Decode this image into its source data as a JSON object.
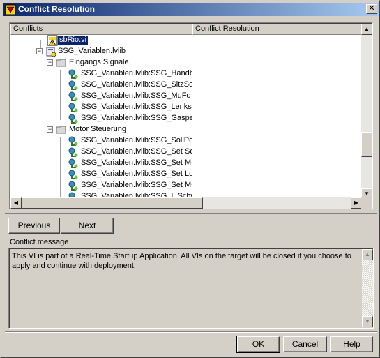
{
  "window": {
    "title": "Conflict Resolution",
    "close_glyph": "✕"
  },
  "columns": {
    "conflicts": "Conflicts",
    "resolution": "Conflict Resolution"
  },
  "tree": {
    "items": [
      {
        "label": "sbRio.vi",
        "selected": true
      },
      {
        "label": "SSG_Variablen.lvlib"
      },
      {
        "label": "Eingangs Signale"
      },
      {
        "label": "SSG_Variablen.lvlib:SSG_Handbo"
      },
      {
        "label": "SSG_Variablen.lvlib:SSG_SitzScha"
      },
      {
        "label": "SSG_Variablen.lvlib:SSG_MuFo"
      },
      {
        "label": "SSG_Variablen.lvlib:SSG_Lenksch"
      },
      {
        "label": "SSG_Variablen.lvlib:SSG_Gasped"
      },
      {
        "label": "Motor Steuerung"
      },
      {
        "label": "SSG_Variablen.lvlib:SSG_SollPosit"
      },
      {
        "label": "SSG_Variablen.lvlib:SSG_Set Solll"
      },
      {
        "label": "SSG_Variablen.lvlib:SSG_Set M-"
      },
      {
        "label": "SSG_Variablen.lvlib:SSG_Set Lorc"
      },
      {
        "label": "SSG_Variablen.lvlib:SSG_Set M+"
      },
      {
        "label": "SSG_Variablen.lvlib:SSG_I_Schwe"
      }
    ],
    "expander_minus": "−"
  },
  "nav": {
    "previous": "Previous",
    "next": "Next"
  },
  "message": {
    "label": "Conflict message",
    "text": "This VI is part of a Real-Time Startup Application. All VIs on the target will be closed if you choose to apply and continue with deployment."
  },
  "footer": {
    "ok": "OK",
    "cancel": "Cancel",
    "help": "Help"
  },
  "scroll": {
    "up": "▲",
    "down": "▼",
    "left": "◀",
    "right": "▶"
  },
  "icons": {
    "title": "labview-app-icon",
    "vi": "vi-warning-icon",
    "library": "library-icon",
    "folder": "folder-icon",
    "variable": "shared-variable-icon"
  },
  "colors": {
    "titlebar_start": "#0a246a",
    "titlebar_end": "#a6caf0",
    "selection": "#0a246a",
    "face": "#d4d0c8"
  }
}
